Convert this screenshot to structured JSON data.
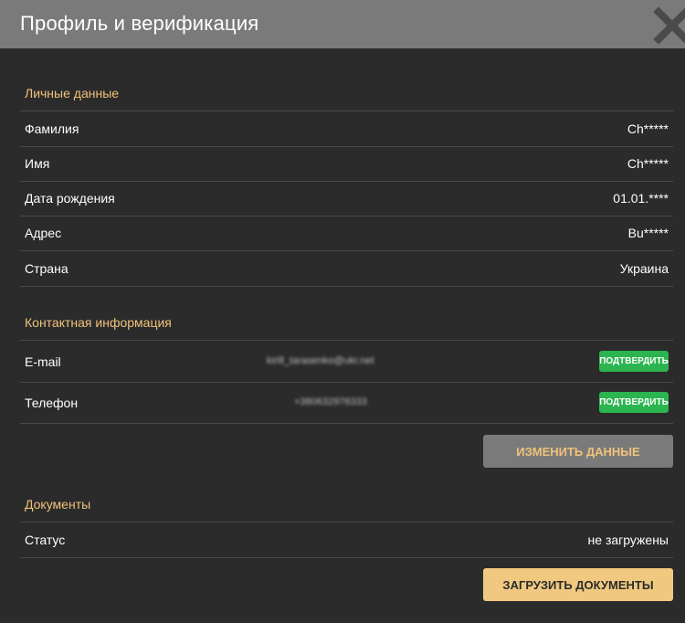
{
  "header": {
    "title": "Профиль и верификация",
    "close_icon": "close-icon"
  },
  "personal": {
    "title": "Личные данные",
    "rows": [
      {
        "label": "Фамилия",
        "value": "Ch*****"
      },
      {
        "label": "Имя",
        "value": "Ch*****"
      },
      {
        "label": "Дата рождения",
        "value": "01.01.****"
      },
      {
        "label": "Адрес",
        "value": "Bu*****"
      },
      {
        "label": "Страна",
        "value": "Украина"
      }
    ]
  },
  "contact": {
    "title": "Контактная информация",
    "rows": [
      {
        "label": "E-mail",
        "value": "kirill_tarasenko@ukr.net",
        "button": "ПОДТВЕРДИТЬ"
      },
      {
        "label": "Телефон",
        "value": "+380632976333",
        "button": "ПОДТВЕРДИТЬ"
      }
    ],
    "edit_button": "ИЗМЕНИТЬ ДАННЫЕ"
  },
  "documents": {
    "title": "Документы",
    "status_label": "Статус",
    "status_value": "не загружены",
    "upload_button": "ЗАГРУЗИТЬ ДОКУМЕНТЫ"
  },
  "colors": {
    "header_bg": "#7a7a7a",
    "page_bg": "#2b2b2b",
    "section_title": "#f0c27a",
    "verify_green": "#2bb44f",
    "upload_gold": "#f0c87f"
  }
}
